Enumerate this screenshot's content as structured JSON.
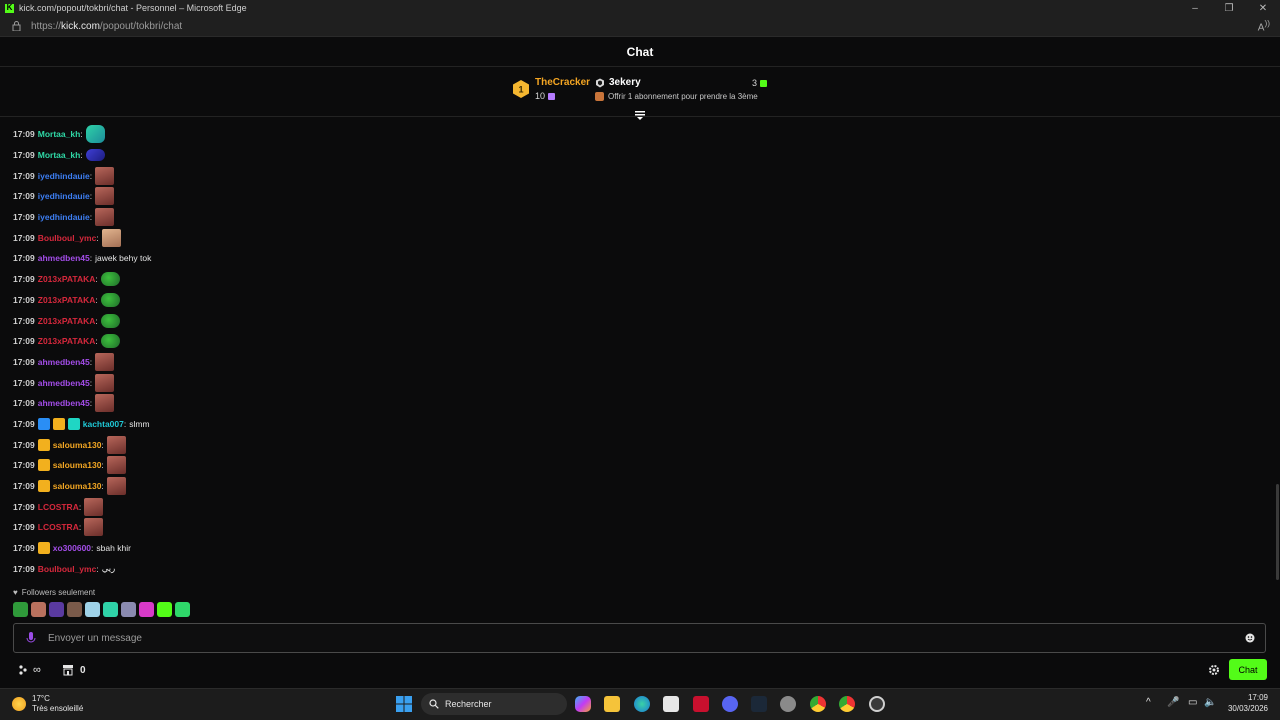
{
  "window": {
    "title": "kick.com/popout/tokbri/chat - Personnel – Microsoft Edge",
    "url_prefix": "https://",
    "url_domain": "kick.com",
    "url_path": "/popout/tokbri/chat"
  },
  "chat": {
    "header": "Chat",
    "leaderboard": {
      "rank1_badge": "1",
      "rank1_name": "TheCracker",
      "rank1_count": "10",
      "rank2_name": "3ekery",
      "rank2_count": "3",
      "offer_text": "Offrir 1 abonnement pour prendre la 3ème"
    },
    "messages": [
      {
        "time": "17:09",
        "user": "Mortaa_kh",
        "color": "#2fd8a6",
        "emote": "teal",
        "text": ""
      },
      {
        "time": "17:09",
        "user": "Mortaa_kh",
        "color": "#2fd8a6",
        "emote": "blue",
        "text": ""
      },
      {
        "time": "17:09",
        "user": "iyedhindauie",
        "color": "#3d7ef2",
        "emote": "face",
        "text": ""
      },
      {
        "time": "17:09",
        "user": "iyedhindauie",
        "color": "#3d7ef2",
        "emote": "face",
        "text": ""
      },
      {
        "time": "17:09",
        "user": "iyedhindauie",
        "color": "#3d7ef2",
        "emote": "face",
        "text": ""
      },
      {
        "time": "17:09",
        "user": "Boulboul_ymc",
        "color": "#d6283c",
        "emote": "face2",
        "text": ""
      },
      {
        "time": "17:09",
        "user": "ahmedben45",
        "color": "#a34de8",
        "emote": "",
        "text": "jawek behy tok"
      },
      {
        "time": "17:09",
        "user": "Z013xPATAKA",
        "color": "#d6283c",
        "emote": "pepe",
        "text": ""
      },
      {
        "time": "17:09",
        "user": "Z013xPATAKA",
        "color": "#d6283c",
        "emote": "pepe",
        "text": ""
      },
      {
        "time": "17:09",
        "user": "Z013xPATAKA",
        "color": "#d6283c",
        "emote": "pepe",
        "text": ""
      },
      {
        "time": "17:09",
        "user": "Z013xPATAKA",
        "color": "#d6283c",
        "emote": "pepe",
        "text": ""
      },
      {
        "time": "17:09",
        "user": "ahmedben45",
        "color": "#a34de8",
        "emote": "face",
        "text": ""
      },
      {
        "time": "17:09",
        "user": "ahmedben45",
        "color": "#a34de8",
        "emote": "face",
        "text": ""
      },
      {
        "time": "17:09",
        "user": "ahmedben45",
        "color": "#a34de8",
        "emote": "face",
        "text": ""
      },
      {
        "time": "17:09",
        "user": "kachta007",
        "color": "#1fc8d6",
        "badges": [
          "blue",
          "gold",
          "teal"
        ],
        "emote": "",
        "text": "slmm"
      },
      {
        "time": "17:09",
        "user": "salouma130",
        "color": "#f2a623",
        "badges": [
          "gold"
        ],
        "emote": "face",
        "text": ""
      },
      {
        "time": "17:09",
        "user": "salouma130",
        "color": "#f2a623",
        "badges": [
          "gold"
        ],
        "emote": "face",
        "text": ""
      },
      {
        "time": "17:09",
        "user": "salouma130",
        "color": "#f2a623",
        "badges": [
          "gold"
        ],
        "emote": "face",
        "text": ""
      },
      {
        "time": "17:09",
        "user": "LCOSTRA",
        "color": "#d6283c",
        "emote": "face",
        "text": ""
      },
      {
        "time": "17:09",
        "user": "LCOSTRA",
        "color": "#d6283c",
        "emote": "face",
        "text": ""
      },
      {
        "time": "17:09",
        "user": "xo300600",
        "color": "#a34de8",
        "badges": [
          "gold"
        ],
        "emote": "",
        "text": "sbah khir"
      },
      {
        "time": "17:09",
        "user": "Boulboul_ymc",
        "color": "#d6283c",
        "emote": "",
        "text": "ريي"
      }
    ],
    "followers_only": "Followers seulement",
    "input_placeholder": "Envoyer un message",
    "store_count": "0",
    "send_label": "Chat"
  },
  "taskbar": {
    "weather_temp": "17°C",
    "weather_desc": "Très ensoleillé",
    "search_label": "Rechercher",
    "time": "17:09",
    "date": "30/03/2026"
  },
  "colors": {
    "accent": "#53fc18",
    "background": "#0b0b0c"
  }
}
